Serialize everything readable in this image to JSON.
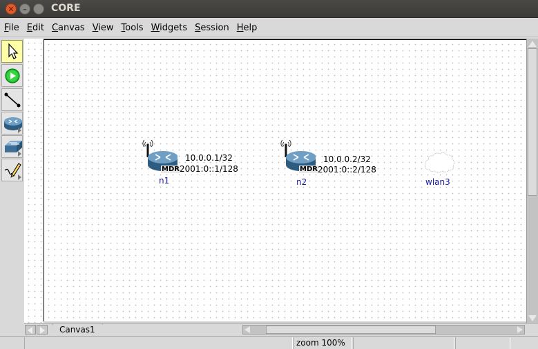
{
  "window": {
    "title": "CORE"
  },
  "menu": {
    "items": [
      {
        "label": "File",
        "u": "F",
        "rest": "ile"
      },
      {
        "label": "Edit",
        "u": "E",
        "rest": "dit"
      },
      {
        "label": "Canvas",
        "u": "C",
        "rest": "anvas"
      },
      {
        "label": "View",
        "u": "V",
        "rest": "iew"
      },
      {
        "label": "Tools",
        "u": "T",
        "rest": "ools"
      },
      {
        "label": "Widgets",
        "u": "W",
        "rest": "idgets"
      },
      {
        "label": "Session",
        "u": "S",
        "rest": "ession"
      },
      {
        "label": "Help",
        "u": "H",
        "rest": "elp"
      }
    ]
  },
  "toolbar": {
    "tools": [
      "select-icon",
      "start-session-icon",
      "link-tool-icon",
      "router-tool-icon",
      "switch-tool-icon",
      "annotation-tool-icon"
    ]
  },
  "nodes": [
    {
      "name": "n1",
      "badge": "MDR",
      "ipv4": "10.0.0.1/32",
      "ipv6": "2001:0::1/128"
    },
    {
      "name": "n2",
      "badge": "MDR",
      "ipv4": "10.0.0.2/32",
      "ipv6": "2001:0::2/128"
    },
    {
      "name": "wlan3"
    }
  ],
  "tabs": {
    "canvas": "Canvas1"
  },
  "status": {
    "zoom": "zoom 100%"
  },
  "colors": {
    "node_label": "#1a1aa6",
    "router_blue": "#3f6f95",
    "active_tool": "#ffffa8"
  }
}
